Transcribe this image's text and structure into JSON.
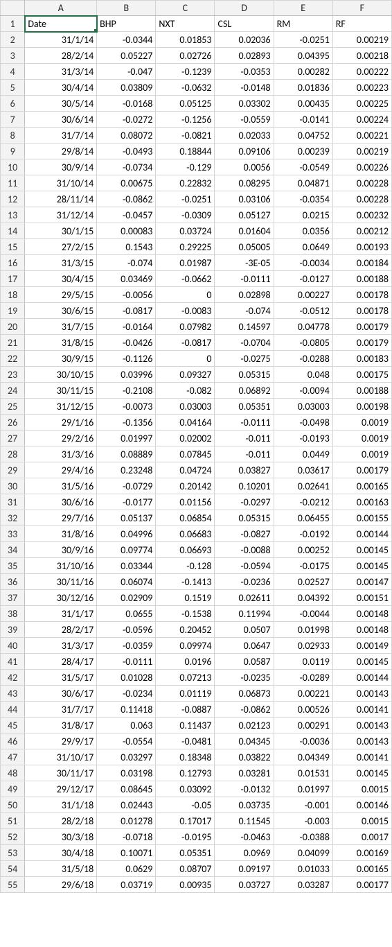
{
  "columns": [
    "A",
    "B",
    "C",
    "D",
    "E",
    "F"
  ],
  "headers": [
    "Date",
    "BHP",
    "NXT",
    "CSL",
    "RM",
    "RF"
  ],
  "active_cell": "A1",
  "rows": [
    [
      "31/1/14",
      "-0.0344",
      "0.01853",
      "0.02036",
      "-0.0251",
      "0.00219"
    ],
    [
      "28/2/14",
      "0.05227",
      "0.02726",
      "0.02893",
      "0.04395",
      "0.00218"
    ],
    [
      "31/3/14",
      "-0.047",
      "-0.1239",
      "-0.0353",
      "0.00282",
      "0.00222"
    ],
    [
      "30/4/14",
      "0.03809",
      "-0.0632",
      "-0.0148",
      "0.01836",
      "0.00223"
    ],
    [
      "30/5/14",
      "-0.0168",
      "0.05125",
      "0.03302",
      "0.00435",
      "0.00225"
    ],
    [
      "30/6/14",
      "-0.0272",
      "-0.1256",
      "-0.0559",
      "-0.0141",
      "0.00224"
    ],
    [
      "31/7/14",
      "0.08072",
      "-0.0821",
      "0.02033",
      "0.04752",
      "0.00221"
    ],
    [
      "29/8/14",
      "-0.0493",
      "0.18844",
      "0.09106",
      "0.00239",
      "0.00219"
    ],
    [
      "30/9/14",
      "-0.0734",
      "-0.129",
      "0.0056",
      "-0.0549",
      "0.00226"
    ],
    [
      "31/10/14",
      "0.00675",
      "0.22832",
      "0.08295",
      "0.04871",
      "0.00228"
    ],
    [
      "28/11/14",
      "-0.0862",
      "-0.0251",
      "0.03106",
      "-0.0354",
      "0.00228"
    ],
    [
      "31/12/14",
      "-0.0457",
      "-0.0309",
      "0.05127",
      "0.0215",
      "0.00232"
    ],
    [
      "30/1/15",
      "0.00083",
      "0.03724",
      "0.01604",
      "0.0356",
      "0.00212"
    ],
    [
      "27/2/15",
      "0.1543",
      "0.29225",
      "0.05005",
      "0.0649",
      "0.00193"
    ],
    [
      "31/3/15",
      "-0.074",
      "0.01987",
      "-3E-05",
      "-0.0034",
      "0.00184"
    ],
    [
      "30/4/15",
      "0.03469",
      "-0.0662",
      "-0.0111",
      "-0.0127",
      "0.00188"
    ],
    [
      "29/5/15",
      "-0.0056",
      "0",
      "0.02898",
      "0.00227",
      "0.00178"
    ],
    [
      "30/6/15",
      "-0.0817",
      "-0.0083",
      "-0.074",
      "-0.0512",
      "0.00178"
    ],
    [
      "31/7/15",
      "-0.0164",
      "0.07982",
      "0.14597",
      "0.04778",
      "0.00179"
    ],
    [
      "31/8/15",
      "-0.0426",
      "-0.0817",
      "-0.0704",
      "-0.0805",
      "0.00179"
    ],
    [
      "30/9/15",
      "-0.1126",
      "0",
      "-0.0275",
      "-0.0288",
      "0.00183"
    ],
    [
      "30/10/15",
      "0.03996",
      "0.09327",
      "0.05315",
      "0.048",
      "0.00175"
    ],
    [
      "30/11/15",
      "-0.2108",
      "-0.082",
      "0.06892",
      "-0.0094",
      "0.00188"
    ],
    [
      "31/12/15",
      "-0.0073",
      "0.03003",
      "0.05351",
      "0.03003",
      "0.00198"
    ],
    [
      "29/1/16",
      "-0.1356",
      "0.04164",
      "-0.0111",
      "-0.0498",
      "0.0019"
    ],
    [
      "29/2/16",
      "0.01997",
      "0.02002",
      "-0.011",
      "-0.0193",
      "0.0019"
    ],
    [
      "31/3/16",
      "0.08889",
      "0.07845",
      "-0.011",
      "0.0449",
      "0.0019"
    ],
    [
      "29/4/16",
      "0.23248",
      "0.04724",
      "0.03827",
      "0.03617",
      "0.00179"
    ],
    [
      "31/5/16",
      "-0.0729",
      "0.20142",
      "0.10201",
      "0.02641",
      "0.00165"
    ],
    [
      "30/6/16",
      "-0.0177",
      "0.01156",
      "-0.0297",
      "-0.0212",
      "0.00163"
    ],
    [
      "29/7/16",
      "0.05137",
      "0.06854",
      "0.05315",
      "0.06455",
      "0.00155"
    ],
    [
      "31/8/16",
      "0.04996",
      "0.06683",
      "-0.0827",
      "-0.0192",
      "0.00144"
    ],
    [
      "30/9/16",
      "0.09774",
      "0.06693",
      "-0.0088",
      "0.00252",
      "0.00145"
    ],
    [
      "31/10/16",
      "0.03344",
      "-0.128",
      "-0.0594",
      "-0.0175",
      "0.00145"
    ],
    [
      "30/11/16",
      "0.06074",
      "-0.1413",
      "-0.0236",
      "0.02527",
      "0.00147"
    ],
    [
      "30/12/16",
      "0.02909",
      "0.1519",
      "0.02611",
      "0.04392",
      "0.00151"
    ],
    [
      "31/1/17",
      "0.0655",
      "-0.1538",
      "0.11994",
      "-0.0044",
      "0.00148"
    ],
    [
      "28/2/17",
      "-0.0596",
      "0.20452",
      "0.0507",
      "0.01998",
      "0.00148"
    ],
    [
      "31/3/17",
      "-0.0359",
      "0.09974",
      "0.0647",
      "0.02933",
      "0.00149"
    ],
    [
      "28/4/17",
      "-0.0111",
      "0.0196",
      "0.0587",
      "0.0119",
      "0.00145"
    ],
    [
      "31/5/17",
      "0.01028",
      "0.07213",
      "-0.0235",
      "-0.0289",
      "0.00144"
    ],
    [
      "30/6/17",
      "-0.0234",
      "0.01119",
      "0.06873",
      "0.00221",
      "0.00143"
    ],
    [
      "31/7/17",
      "0.11418",
      "-0.0887",
      "-0.0862",
      "0.00526",
      "0.00141"
    ],
    [
      "31/8/17",
      "0.063",
      "0.11437",
      "0.02123",
      "0.00291",
      "0.00143"
    ],
    [
      "29/9/17",
      "-0.0554",
      "-0.0481",
      "0.04345",
      "-0.0036",
      "0.00143"
    ],
    [
      "31/10/17",
      "0.03297",
      "0.18348",
      "0.03822",
      "0.04349",
      "0.00141"
    ],
    [
      "30/11/17",
      "0.03198",
      "0.12793",
      "0.03281",
      "0.01531",
      "0.00145"
    ],
    [
      "29/12/17",
      "0.08645",
      "0.03092",
      "-0.0132",
      "0.01997",
      "0.0015"
    ],
    [
      "31/1/18",
      "0.02443",
      "-0.05",
      "0.03735",
      "-0.001",
      "0.00146"
    ],
    [
      "28/2/18",
      "0.01278",
      "0.17017",
      "0.11545",
      "-0.003",
      "0.0015"
    ],
    [
      "30/3/18",
      "-0.0718",
      "-0.0195",
      "-0.0463",
      "-0.0388",
      "0.0017"
    ],
    [
      "30/4/18",
      "0.10071",
      "0.05351",
      "0.0969",
      "0.04099",
      "0.00169"
    ],
    [
      "31/5/18",
      "0.0629",
      "0.08707",
      "0.09197",
      "0.01033",
      "0.00165"
    ],
    [
      "29/6/18",
      "0.03719",
      "0.00935",
      "0.03727",
      "0.03287",
      "0.00177"
    ]
  ]
}
